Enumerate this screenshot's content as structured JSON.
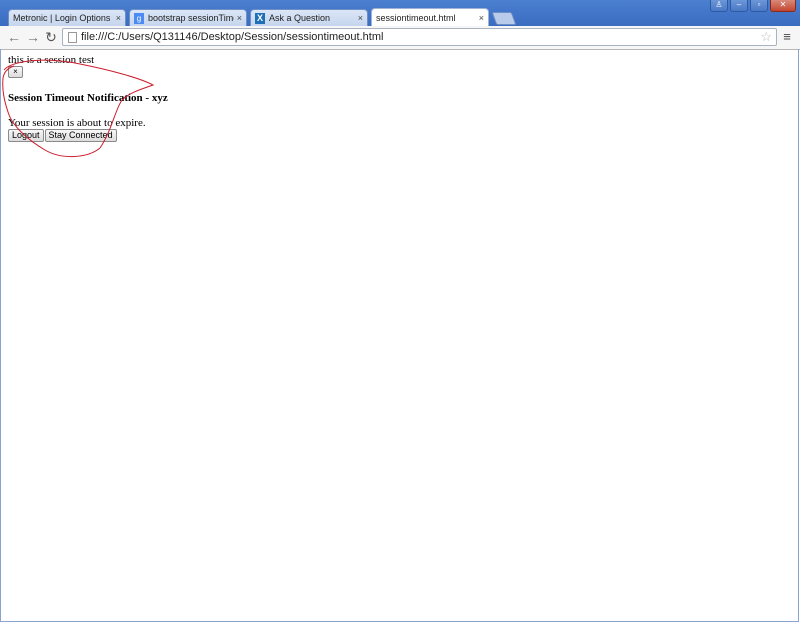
{
  "browser": {
    "tabs": [
      {
        "label": "Metronic | Login Options",
        "icon": "page-icon",
        "close": "×"
      },
      {
        "label": "bootstrap sessionTimeout",
        "icon": "google-icon",
        "icon_glyph": "g",
        "close": "×"
      },
      {
        "label": "Ask a Question",
        "icon": "x-icon",
        "icon_glyph": "X",
        "close": "×"
      },
      {
        "label": "sessiontimeout.html",
        "icon": "page-icon",
        "close": "×",
        "active": true
      }
    ],
    "window_controls": {
      "user": "♙",
      "minimize": "–",
      "restore": "▫",
      "close": "✕"
    },
    "nav": {
      "back": "←",
      "forward": "→",
      "reload": "↻"
    },
    "address": "file:///C:/Users/Q131146/Desktop/Session/sessiontimeout.html",
    "star": "☆",
    "menu": "≡"
  },
  "page": {
    "test_text": "this is a session test",
    "close_button": "×",
    "title": "Session Timeout Notification - xyz",
    "message": "Your session is about to expire.",
    "logout_label": "Logout",
    "stay_label": "Stay Connected"
  },
  "colors": {
    "annotation": "#cc1b2a",
    "titlebar": "#3a6cc0"
  }
}
